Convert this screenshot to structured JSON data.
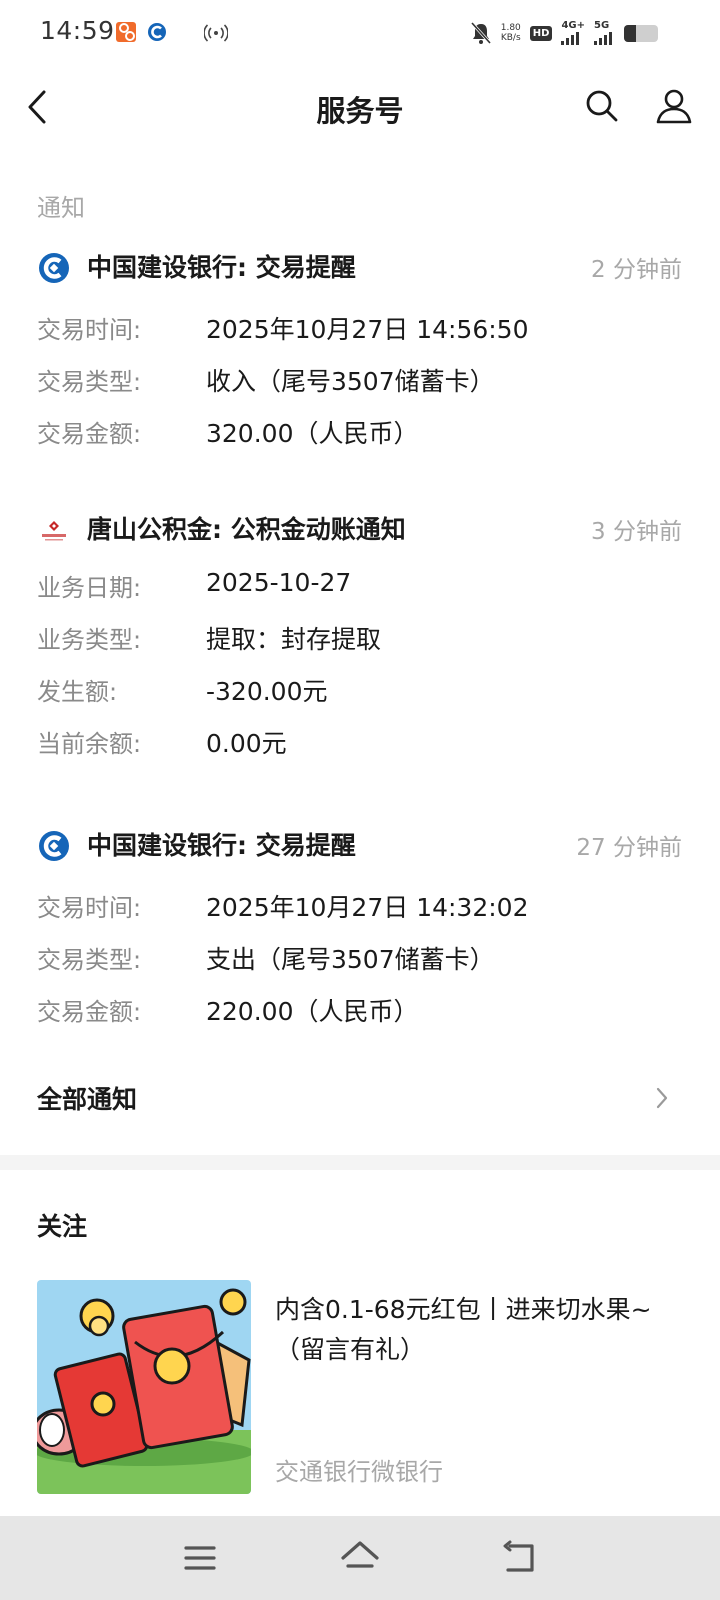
{
  "status_bar": {
    "time": "14:59",
    "net_speed_value": "1.80",
    "net_speed_unit": "KB/s",
    "hd_badge": "HD",
    "network_4g": "4G+",
    "network_5g": "5G",
    "battery_level": 0.35
  },
  "header": {
    "title": "服务号"
  },
  "notices": {
    "section_title": "通知",
    "items": [
      {
        "title": "中国建设银行: 交易提醒",
        "time": "2 分钟前",
        "rows": [
          {
            "label": "交易时间:",
            "value": "2025年10月27日 14:56:50"
          },
          {
            "label": "交易类型:",
            "value": "收入（尾号3507储蓄卡）"
          },
          {
            "label": "交易金额:",
            "value": "320.00（人民币）"
          }
        ]
      },
      {
        "title": "唐山公积金: 公积金动账通知",
        "time": "3 分钟前",
        "rows": [
          {
            "label": "业务日期:",
            "value": "2025-10-27"
          },
          {
            "label": "业务类型:",
            "value": "提取：封存提取"
          },
          {
            "label": "发生额:",
            "value": "-320.00元"
          },
          {
            "label": "当前余额:",
            "value": "0.00元"
          }
        ]
      },
      {
        "title": "中国建设银行: 交易提醒",
        "time": "27 分钟前",
        "rows": [
          {
            "label": "交易时间:",
            "value": "2025年10月27日 14:32:02"
          },
          {
            "label": "交易类型:",
            "value": "支出（尾号3507储蓄卡）"
          },
          {
            "label": "交易金额:",
            "value": "220.00（人民币）"
          }
        ]
      }
    ],
    "all_label": "全部通知"
  },
  "follow": {
    "section_title": "关注",
    "article": {
      "title": "内含0.1-68元红包丨进来切水果~（留言有礼）",
      "source": "交通银行微银行"
    }
  },
  "colors": {
    "ccb_blue": "#1565b8",
    "red_envelope": "#e53935",
    "muted_text": "#a8a8a8"
  },
  "icons": {
    "back": "chevron-left-icon",
    "search": "search-icon",
    "profile": "person-icon",
    "all_notice": "chevron-right-icon",
    "sys_menu": "menu-icon",
    "sys_home": "home-icon",
    "sys_back": "back-icon"
  }
}
